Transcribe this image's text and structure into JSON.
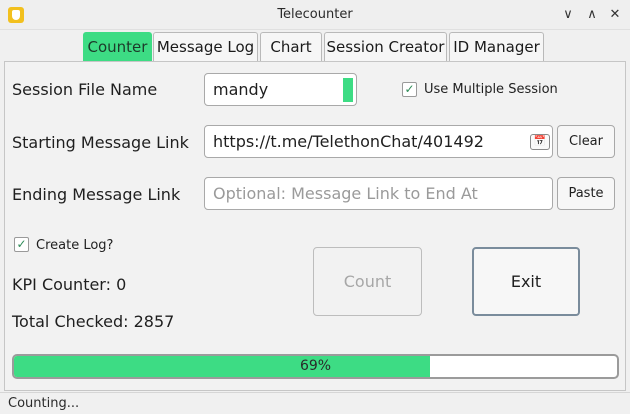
{
  "window": {
    "title": "Telecounter",
    "icons": [
      "app-icon",
      "minimize-icon",
      "maximize-icon",
      "close-icon"
    ],
    "minimize_glyph": "∨",
    "maximize_glyph": "∧",
    "close_glyph": "✕"
  },
  "tabs": [
    {
      "label": "Counter",
      "active": true
    },
    {
      "label": "Message Log"
    },
    {
      "label": "Chart"
    },
    {
      "label": "Session Creator"
    },
    {
      "label": "ID Manager"
    }
  ],
  "form": {
    "session_file_label": "Session File Name",
    "session_file_value": "mandy",
    "use_multiple_label": "Use Multiple Session",
    "use_multiple_checked": true,
    "starting_link_label": "Starting Message Link",
    "starting_link_value": "https://t.me/TelethonChat/401492",
    "clear_label": "Clear",
    "ending_link_label": "Ending Message Link",
    "ending_link_placeholder": "Optional: Message Link to End At",
    "paste_label": "Paste",
    "create_log_label": "Create Log?",
    "create_log_checked": true,
    "checkmark_glyph": "✓",
    "calendar_glyph": "📅"
  },
  "stats": {
    "kpi_counter": "KPI Counter: 0",
    "total_checked": "Total Checked: 2857"
  },
  "buttons": {
    "count": "Count",
    "exit": "Exit"
  },
  "progress": {
    "value": 0.69,
    "text": "69%"
  },
  "status": {
    "text": "Counting..."
  },
  "colors": {
    "accent": "#3ddc84"
  }
}
